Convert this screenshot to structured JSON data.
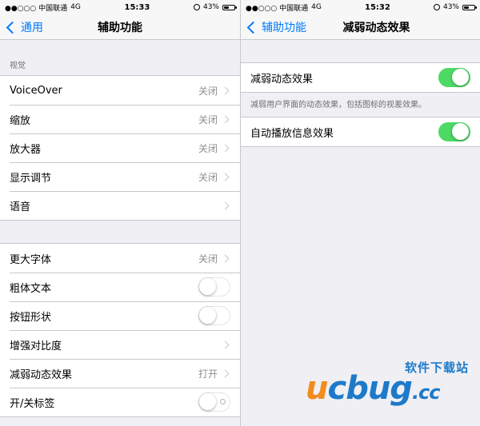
{
  "left": {
    "status": {
      "carrier": "●●○○○ 中国联通",
      "network": "4G",
      "time": "15:33",
      "battery": "43%",
      "battery_level": 0.43
    },
    "nav": {
      "back": "通用",
      "title": "辅助功能"
    },
    "section_vision": "视觉",
    "group1": [
      {
        "label": "VoiceOver",
        "value": "关闭"
      },
      {
        "label": "缩放",
        "value": "关闭"
      },
      {
        "label": "放大器",
        "value": "关闭"
      },
      {
        "label": "显示调节",
        "value": "关闭"
      },
      {
        "label": "语音",
        "value": ""
      }
    ],
    "group2": {
      "larger_text": {
        "label": "更大字体",
        "value": "关闭"
      },
      "bold_text": {
        "label": "粗体文本",
        "on": false
      },
      "button_shapes": {
        "label": "按钮形状",
        "on": false
      },
      "increase_contrast": {
        "label": "增强对比度"
      },
      "reduce_motion": {
        "label": "减弱动态效果",
        "value": "打开"
      },
      "on_off_labels": {
        "label": "开/关标签",
        "on": false
      }
    }
  },
  "right": {
    "status": {
      "carrier": "●●○○○ 中国联通",
      "network": "4G",
      "time": "15:32",
      "battery": "43%",
      "battery_level": 0.43
    },
    "nav": {
      "back": "辅助功能",
      "title": "减弱动态效果"
    },
    "reduce_motion": {
      "label": "减弱动态效果",
      "on": true
    },
    "reduce_motion_note": "减弱用户界面的动态效果，包括图标的视差效果。",
    "auto_play": {
      "label": "自动播放信息效果",
      "on": true
    }
  },
  "watermark": {
    "top": "软件下载站",
    "u": "u",
    "rest": "cbug",
    "cc": ".cc"
  },
  "colors": {
    "accent": "#007aff",
    "toggle_on": "#4cd964",
    "background": "#efeff4",
    "watermark_blue": "#1e7ac9",
    "watermark_orange": "#f28c1c"
  }
}
